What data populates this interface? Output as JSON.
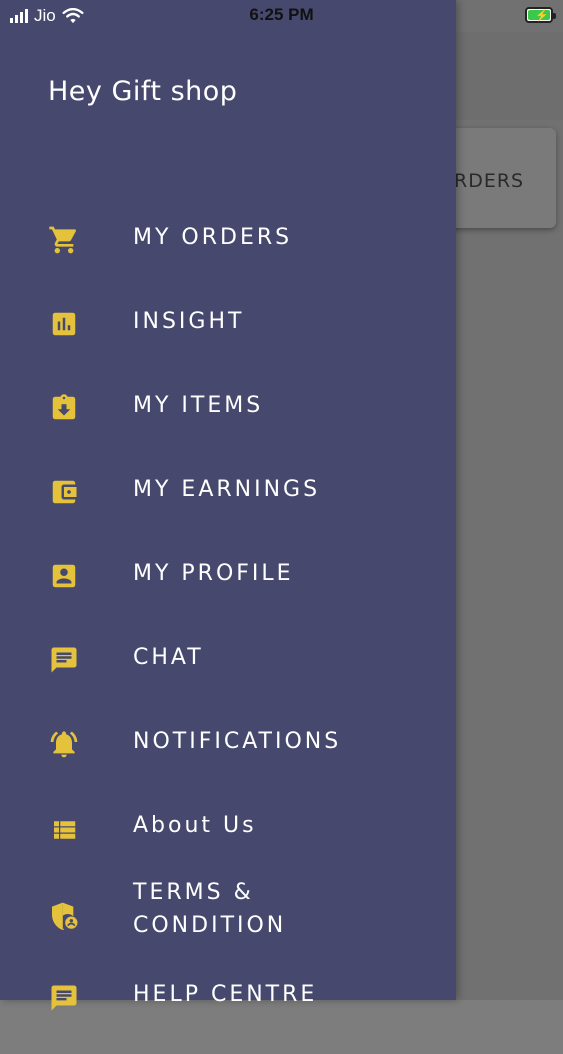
{
  "status_bar": {
    "carrier": "Jio",
    "time": "6:25 PM"
  },
  "background_screen": {
    "card_label": "RDERS"
  },
  "drawer": {
    "title": "Hey Gift shop",
    "items": [
      {
        "label": "MY ORDERS",
        "icon": "cart-icon"
      },
      {
        "label": "INSIGHT",
        "icon": "chart-icon"
      },
      {
        "label": "MY ITEMS",
        "icon": "items-icon"
      },
      {
        "label": "MY EARNINGS",
        "icon": "wallet-icon"
      },
      {
        "label": "MY PROFILE",
        "icon": "profile-icon"
      },
      {
        "label": "CHAT",
        "icon": "chat-icon"
      },
      {
        "label": "NOTIFICATIONS",
        "icon": "bell-icon"
      },
      {
        "label": "About Us",
        "icon": "list-icon"
      },
      {
        "label": "TERMS & CONDITION",
        "label_line1": "TERMS &",
        "label_line2": "CONDITION",
        "icon": "shield-icon"
      },
      {
        "label": "HELP CENTRE",
        "icon": "help-icon"
      }
    ]
  },
  "colors": {
    "drawer_bg": "#46496d",
    "icon_accent": "#e5c23c",
    "text": "#ffffff"
  }
}
